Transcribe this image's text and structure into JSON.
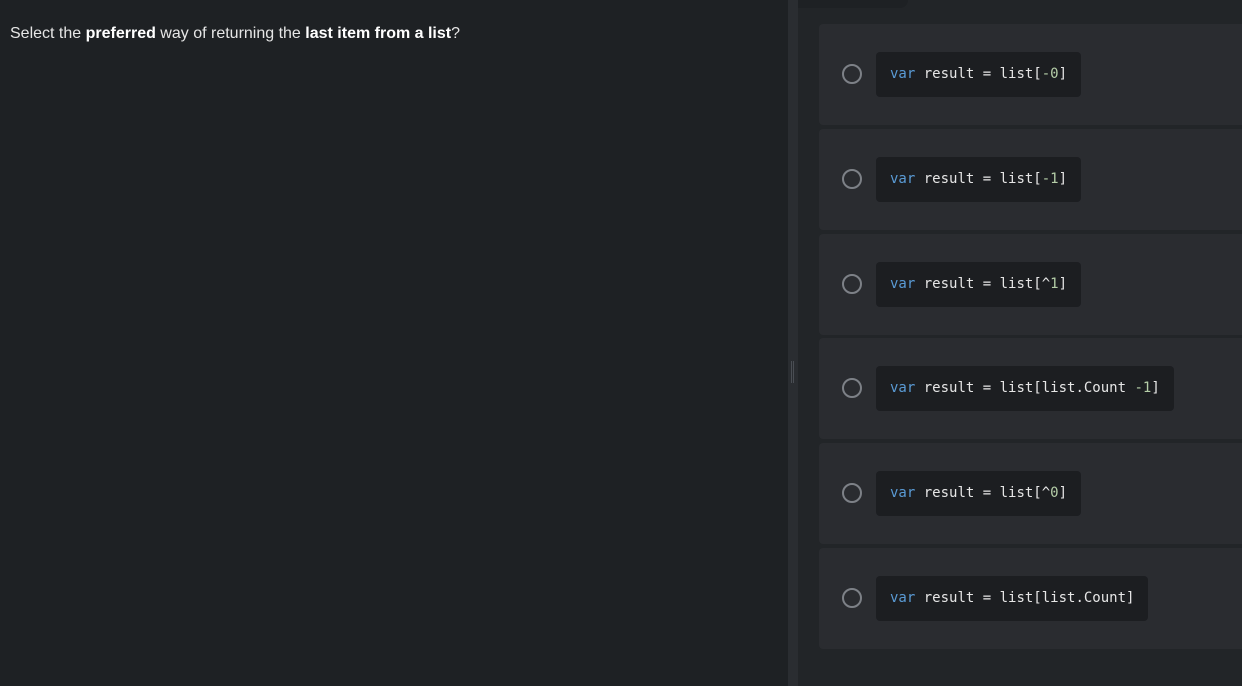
{
  "question": {
    "part1": "Select the ",
    "bold1": "preferred",
    "part2": " way of returning the ",
    "bold2": "last item from a list",
    "part3": "?"
  },
  "options": [
    {
      "keyword": "var",
      "before": " result = list[",
      "number": "-0",
      "after": "]"
    },
    {
      "keyword": "var",
      "before": " result = list[",
      "number": "-1",
      "after": "]"
    },
    {
      "keyword": "var",
      "before": " result = list[^",
      "number": "1",
      "after": "]"
    },
    {
      "keyword": "var",
      "before": " result = list[list.Count ",
      "number": "-1",
      "after": "]"
    },
    {
      "keyword": "var",
      "before": " result = list[^",
      "number": "0",
      "after": "]"
    },
    {
      "keyword": "var",
      "before": " result = list[list.Count]",
      "number": "",
      "after": ""
    }
  ],
  "colors": {
    "background": "#1e2124",
    "panel": "#2a2c30",
    "keyword": "#5a9bd5",
    "number": "#b5cea8"
  },
  "icons": {
    "radio": "radio-button-unchecked",
    "grip": "vertical-grip-icon"
  }
}
